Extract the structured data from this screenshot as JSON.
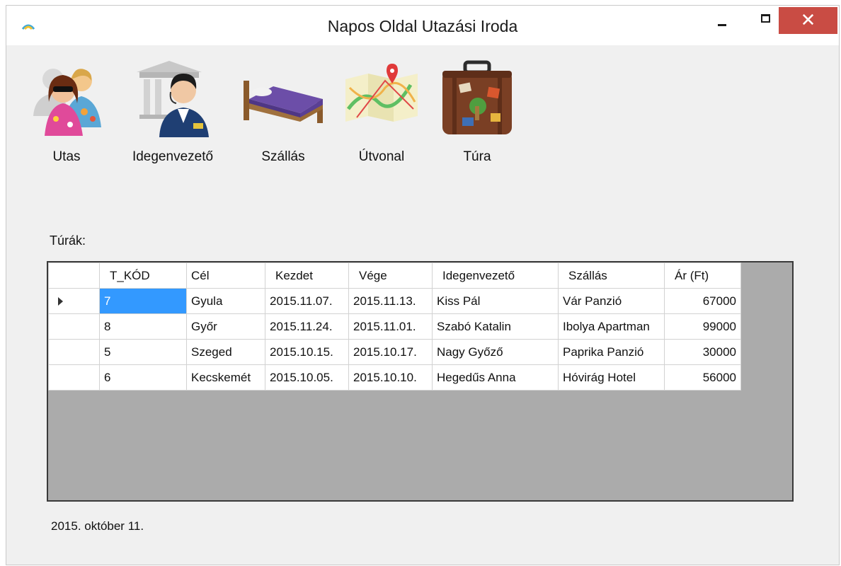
{
  "window": {
    "title": "Napos Oldal Utazási Iroda",
    "close_glyph": "✕"
  },
  "toolbar": {
    "items": [
      {
        "label": "Utas",
        "icon": "people-icon"
      },
      {
        "label": "Idegenvezető",
        "icon": "guide-icon"
      },
      {
        "label": "Szállás",
        "icon": "bed-icon"
      },
      {
        "label": "Útvonal",
        "icon": "map-icon"
      },
      {
        "label": "Túra",
        "icon": "suitcase-icon"
      }
    ]
  },
  "tours": {
    "label": "Túrák:",
    "columns": [
      "T_KÓD",
      "Cél",
      "Kezdet",
      "Vége",
      "Idegenvezető",
      "Szállás",
      "Ár (Ft)"
    ],
    "rows": [
      [
        "7",
        "Gyula",
        "2015.11.07.",
        "2015.11.13.",
        "Kiss Pál",
        "Vár Panzió",
        "67000"
      ],
      [
        "8",
        "Győr",
        "2015.11.24.",
        "2015.11.01.",
        "Szabó Katalin",
        "Ibolya Apartman",
        "99000"
      ],
      [
        "5",
        "Szeged",
        "2015.10.15.",
        "2015.10.17.",
        "Nagy Győző",
        "Paprika Panzió",
        "30000"
      ],
      [
        "6",
        "Kecskemét",
        "2015.10.05.",
        "2015.10.10.",
        "Hegedűs Anna",
        "Hóvirág Hotel",
        "56000"
      ]
    ],
    "selected_row": 0
  },
  "status": {
    "date": "2015. október 11."
  },
  "colors": {
    "selection": "#3399ff",
    "close_button": "#c94c44",
    "grid_background": "#ababab"
  }
}
